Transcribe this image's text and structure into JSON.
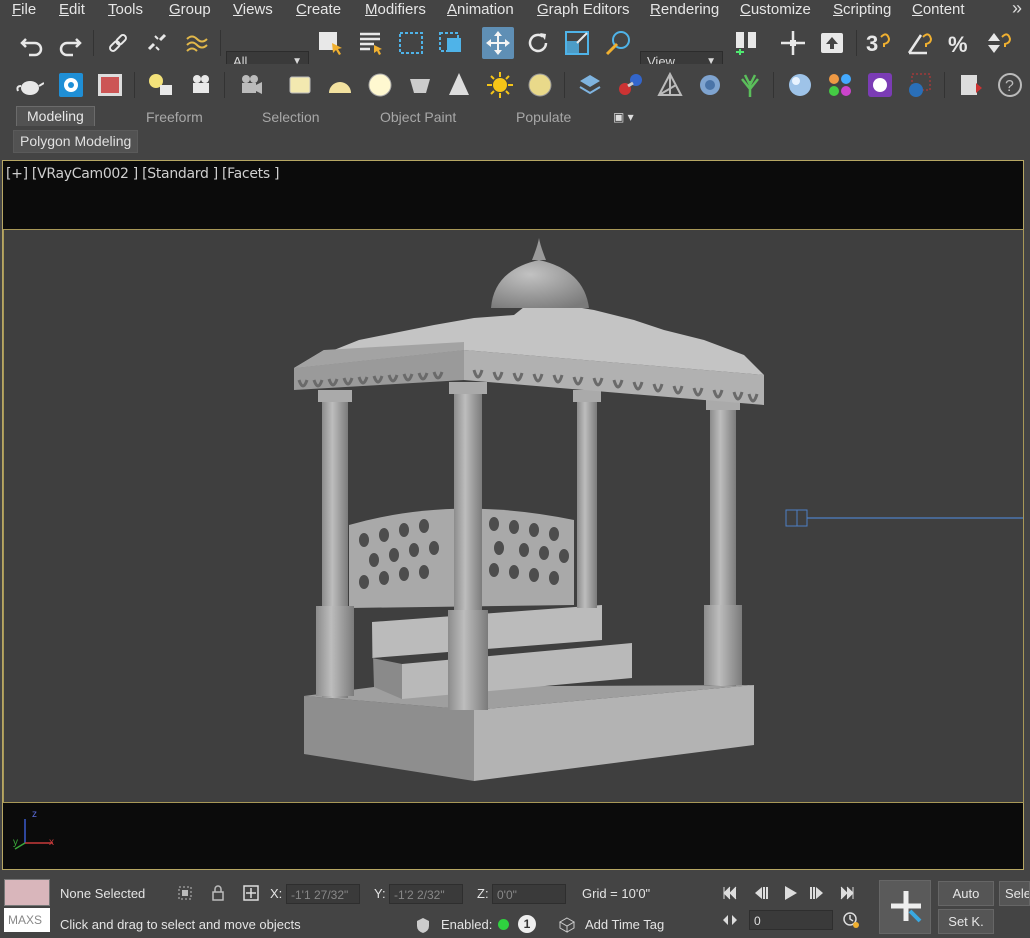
{
  "menu": [
    "File",
    "Edit",
    "Tools",
    "Group",
    "Views",
    "Create",
    "Modifiers",
    "Animation",
    "Graph Editors",
    "Rendering",
    "Customize",
    "Scripting",
    "Content"
  ],
  "menu_more": "»",
  "toolbar": {
    "selection_filter": "All",
    "reference_coord": "View"
  },
  "ribbon": {
    "tabs": [
      "Modeling",
      "Freeform",
      "Selection",
      "Object Paint",
      "Populate"
    ],
    "panel_label": "Polygon Modeling"
  },
  "viewport": {
    "label": "[+] [VRayCam002 ] [Standard ] [Facets ]",
    "axis_z": "z",
    "axis_y": "y",
    "axis_x": "x"
  },
  "status": {
    "selection": "None Selected",
    "prompt": "Click and drag to select and move objects",
    "maxscript": "MAXS",
    "x_label": "X:",
    "x_value": "-1'1 27/32\"",
    "y_label": "Y:",
    "y_value": "-1'2 2/32\"",
    "z_label": "Z:",
    "z_value": "0'0\"",
    "grid": "Grid = 10'0\"",
    "enabled_label": "Enabled:",
    "enabled_count": "1",
    "add_time_tag": "Add Time Tag",
    "frame": "0",
    "auto": "Auto",
    "set_key": "Set K.",
    "selected": "Sele"
  },
  "colors": {
    "accent": "#5f8fb5",
    "viewport_border": "#b7a764",
    "swatch": "#d9b6bb"
  }
}
